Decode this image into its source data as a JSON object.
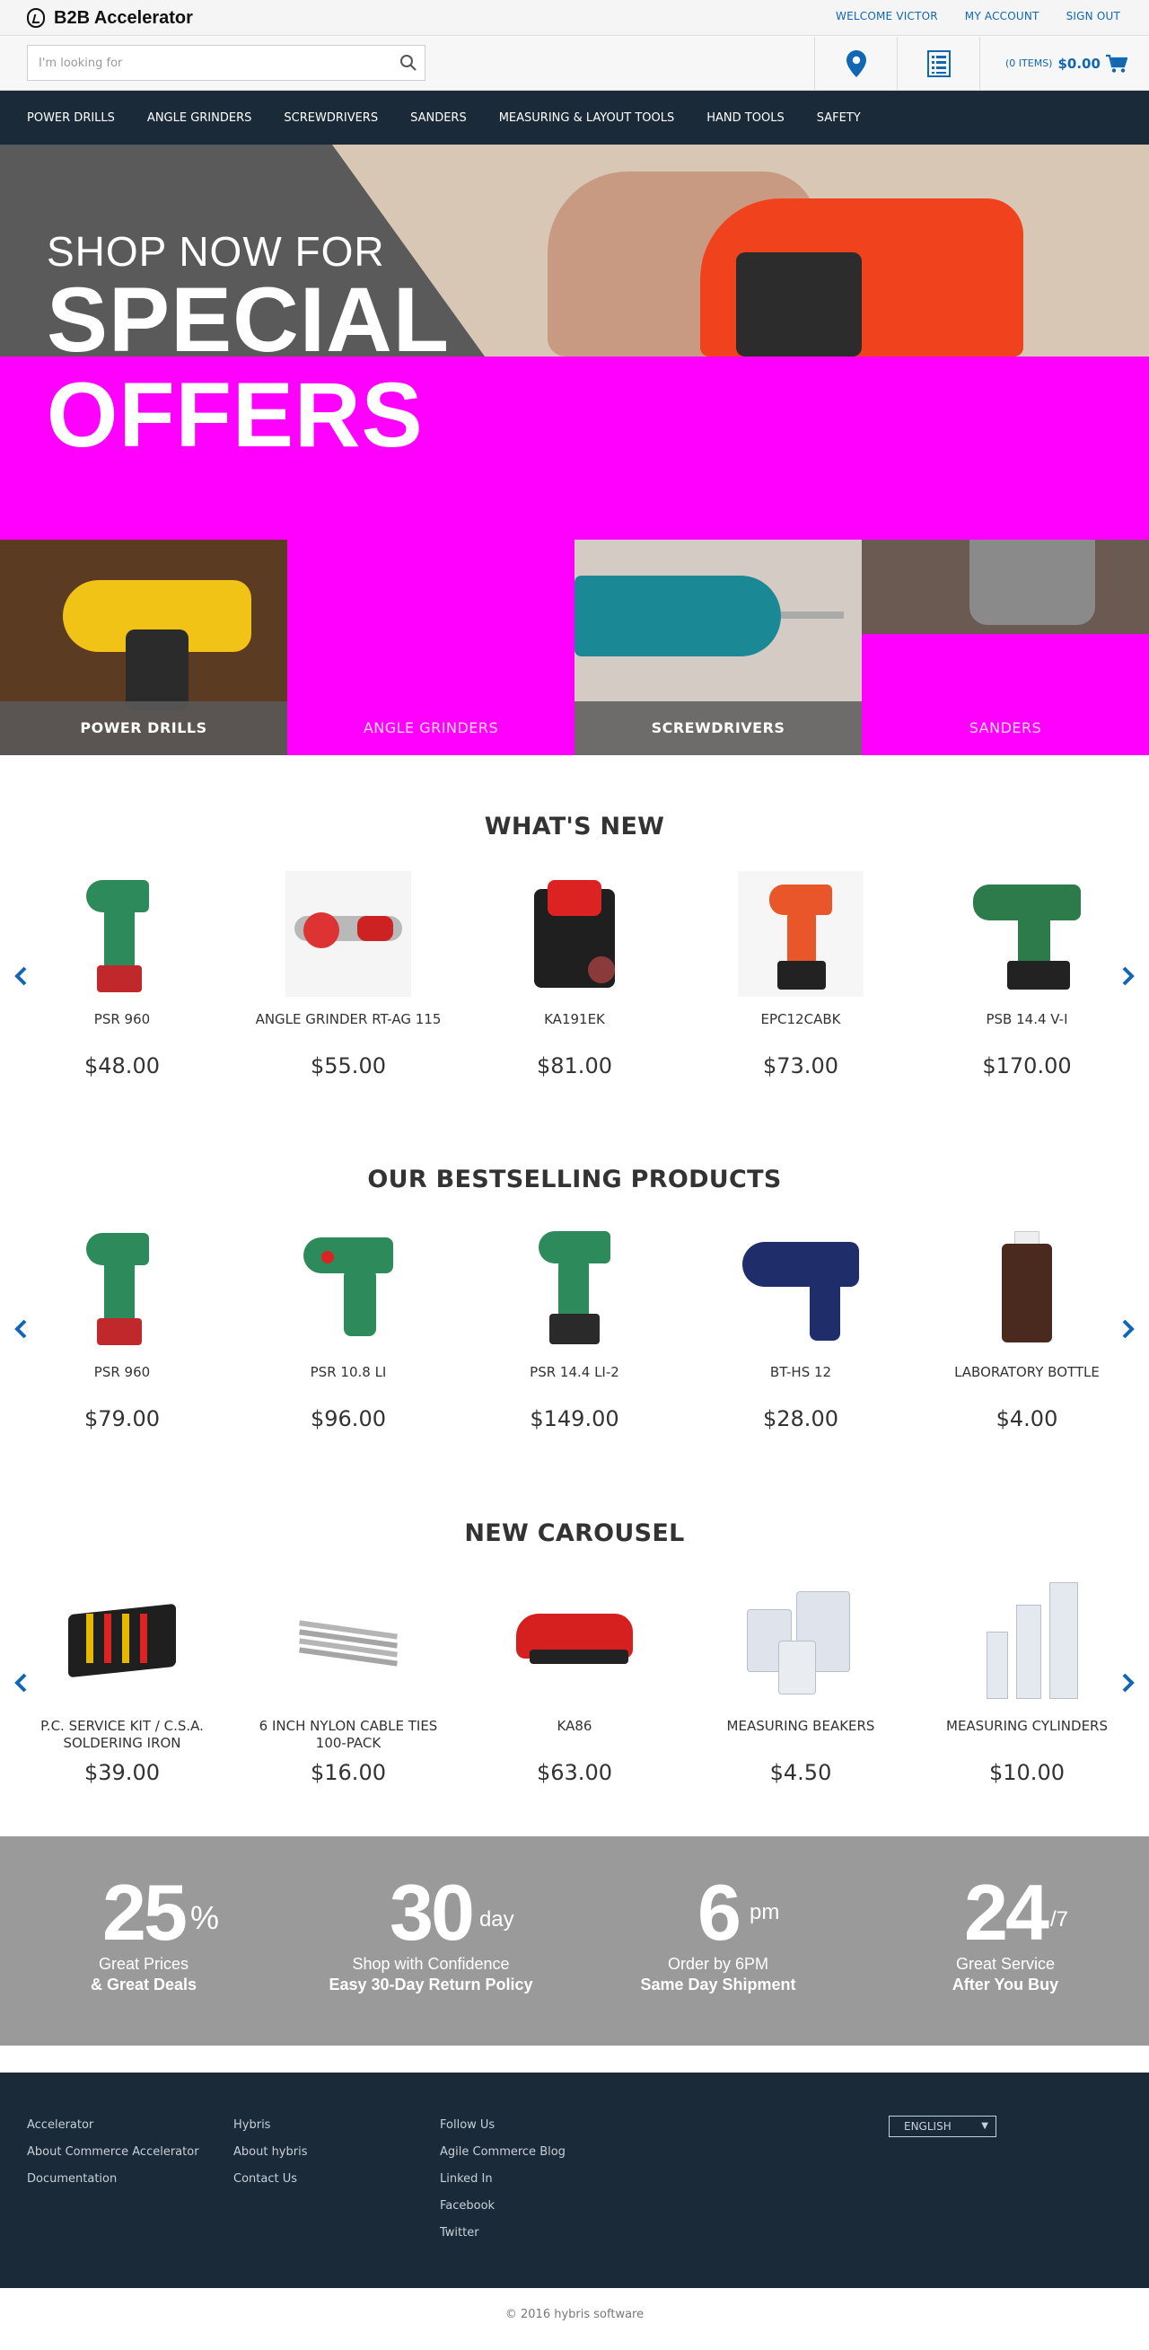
{
  "header": {
    "logo_text": "B2B Accelerator",
    "links": [
      "WELCOME VICTOR",
      "MY ACCOUNT",
      "SIGN OUT"
    ],
    "search_placeholder": "I'm looking for",
    "cart_items": "(0 ITEMS)",
    "cart_total": "$0.00"
  },
  "nav": [
    "POWER DRILLS",
    "ANGLE GRINDERS",
    "SCREWDRIVERS",
    "SANDERS",
    "MEASURING & LAYOUT TOOLS",
    "HAND TOOLS",
    "SAFETY"
  ],
  "hero": {
    "line1": "SHOP NOW FOR",
    "line2": "SPECIAL",
    "line3": "OFFERS"
  },
  "tiles": [
    "POWER DRILLS",
    "ANGLE GRINDERS",
    "SCREWDRIVERS",
    "SANDERS"
  ],
  "whats_new": {
    "title": "WHAT'S NEW",
    "items": [
      {
        "name": "PSR 960",
        "price": "$48.00"
      },
      {
        "name": "ANGLE GRINDER RT-AG 115",
        "price": "$55.00"
      },
      {
        "name": "KA191EK",
        "price": "$81.00"
      },
      {
        "name": "EPC12CABK",
        "price": "$73.00"
      },
      {
        "name": "PSB 14.4 V-I",
        "price": "$170.00"
      }
    ]
  },
  "bestselling": {
    "title": "OUR BESTSELLING PRODUCTS",
    "items": [
      {
        "name": "PSR 960",
        "price": "$79.00"
      },
      {
        "name": "PSR 10.8 LI",
        "price": "$96.00"
      },
      {
        "name": "PSR 14.4 LI-2",
        "price": "$149.00"
      },
      {
        "name": "BT-HS 12",
        "price": "$28.00"
      },
      {
        "name": "LABORATORY BOTTLE",
        "price": "$4.00"
      }
    ]
  },
  "new_carousel": {
    "title": "NEW CAROUSEL",
    "items": [
      {
        "name": "P.C. SERVICE KIT / C.S.A. SOLDERING IRON",
        "price": "$39.00"
      },
      {
        "name": "6 INCH NYLON CABLE TIES 100-PACK",
        "price": "$16.00"
      },
      {
        "name": "KA86",
        "price": "$63.00"
      },
      {
        "name": "MEASURING BEAKERS",
        "price": "$4.50"
      },
      {
        "name": "MEASURING CYLINDERS",
        "price": "$10.00"
      }
    ]
  },
  "promo": [
    {
      "num": "25",
      "sup": "%",
      "l1": "Great Prices",
      "l2": "& Great Deals"
    },
    {
      "num": "30",
      "sup": "day",
      "l1": "Shop with Confidence",
      "l2": "Easy 30-Day Return Policy"
    },
    {
      "num": "6",
      "sup": "pm",
      "l1": "Order by 6PM",
      "l2": "Same Day Shipment"
    },
    {
      "num": "24",
      "sup": "/7",
      "l1": "Great Service",
      "l2": "After You Buy"
    }
  ],
  "footer": {
    "col1": [
      "Accelerator",
      "About Commerce Accelerator",
      "Documentation"
    ],
    "col2": [
      "Hybris",
      "About hybris",
      "Contact Us"
    ],
    "col3": [
      "Follow Us",
      "Agile Commerce Blog",
      "Linked In",
      "Facebook",
      "Twitter"
    ],
    "language": "ENGLISH",
    "copyright": "© 2016 hybris software"
  },
  "colors": {
    "nav_bg": "#1a2a38",
    "link_blue": "#1167b1",
    "hero_magenta": "#ff00ff",
    "promo_gray": "#9a9a9a"
  },
  "icons": [
    "logo-icon",
    "search-icon",
    "location-pin-icon",
    "quick-order-list-icon",
    "cart-icon",
    "chevron-left-icon",
    "chevron-right-icon"
  ]
}
